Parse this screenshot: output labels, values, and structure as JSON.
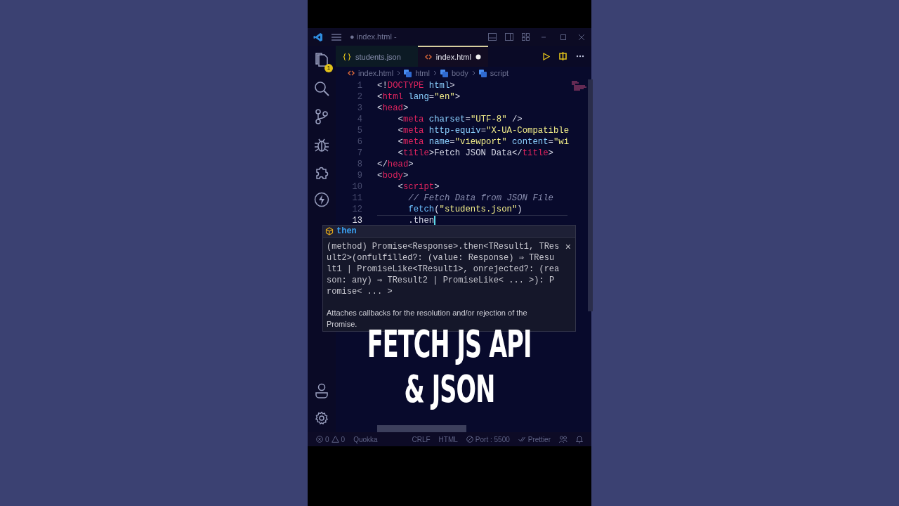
{
  "window": {
    "title": "● index.html -"
  },
  "activity_bar": {
    "explorer_badge": "1"
  },
  "tabs": [
    {
      "label": "students.json",
      "kind": "json",
      "selected": false,
      "modified": false
    },
    {
      "label": "index.html",
      "kind": "html",
      "selected": true,
      "modified": true
    }
  ],
  "breadcrumb": [
    {
      "label": "index.html",
      "kind": "file"
    },
    {
      "label": "html",
      "kind": "element"
    },
    {
      "label": "body",
      "kind": "element"
    },
    {
      "label": "script",
      "kind": "element"
    }
  ],
  "editor": {
    "lines": [
      {
        "number": "1",
        "current": false,
        "tokens": [
          {
            "kind": "punct",
            "text": "<!"
          },
          {
            "kind": "tag",
            "text": "DOCTYPE"
          },
          {
            "kind": "attr",
            "text": " html"
          },
          {
            "kind": "punct",
            "text": ">"
          }
        ]
      },
      {
        "number": "2",
        "current": false,
        "tokens": [
          {
            "kind": "punct",
            "text": "<"
          },
          {
            "kind": "tag",
            "text": "html"
          },
          {
            "kind": "attr",
            "text": " lang"
          },
          {
            "kind": "punct",
            "text": "="
          },
          {
            "kind": "string",
            "text": "\"en\""
          },
          {
            "kind": "punct",
            "text": ">"
          }
        ]
      },
      {
        "number": "3",
        "current": false,
        "tokens": [
          {
            "kind": "punct",
            "text": "<"
          },
          {
            "kind": "tag",
            "text": "head"
          },
          {
            "kind": "punct",
            "text": ">"
          }
        ]
      },
      {
        "number": "4",
        "current": false,
        "tokens": [
          {
            "kind": "punct",
            "text": "    <"
          },
          {
            "kind": "tag",
            "text": "meta"
          },
          {
            "kind": "attr",
            "text": " charset"
          },
          {
            "kind": "punct",
            "text": "="
          },
          {
            "kind": "string",
            "text": "\"UTF-8\""
          },
          {
            "kind": "punct",
            "text": " />"
          }
        ]
      },
      {
        "number": "5",
        "current": false,
        "tokens": [
          {
            "kind": "punct",
            "text": "    <"
          },
          {
            "kind": "tag",
            "text": "meta"
          },
          {
            "kind": "attr",
            "text": " http-equiv"
          },
          {
            "kind": "punct",
            "text": "="
          },
          {
            "kind": "string",
            "text": "\"X-UA-Compatible"
          }
        ]
      },
      {
        "number": "6",
        "current": false,
        "tokens": [
          {
            "kind": "punct",
            "text": "    <"
          },
          {
            "kind": "tag",
            "text": "meta"
          },
          {
            "kind": "attr",
            "text": " name"
          },
          {
            "kind": "punct",
            "text": "="
          },
          {
            "kind": "string",
            "text": "\"viewport\""
          },
          {
            "kind": "attr",
            "text": " content"
          },
          {
            "kind": "punct",
            "text": "="
          },
          {
            "kind": "string",
            "text": "\"wi"
          }
        ]
      },
      {
        "number": "7",
        "current": false,
        "tokens": [
          {
            "kind": "punct",
            "text": "    <"
          },
          {
            "kind": "tag",
            "text": "title"
          },
          {
            "kind": "punct",
            "text": ">Fetch JSON Data</"
          },
          {
            "kind": "tag",
            "text": "title"
          },
          {
            "kind": "punct",
            "text": ">"
          }
        ]
      },
      {
        "number": "8",
        "current": false,
        "tokens": [
          {
            "kind": "punct",
            "text": "</"
          },
          {
            "kind": "tag",
            "text": "head"
          },
          {
            "kind": "punct",
            "text": ">"
          }
        ]
      },
      {
        "number": "9",
        "current": false,
        "tokens": [
          {
            "kind": "punct",
            "text": "<"
          },
          {
            "kind": "tag",
            "text": "body"
          },
          {
            "kind": "punct",
            "text": ">"
          }
        ]
      },
      {
        "number": "10",
        "current": false,
        "tokens": [
          {
            "kind": "punct",
            "text": "    <"
          },
          {
            "kind": "tag",
            "text": "script"
          },
          {
            "kind": "punct",
            "text": ">"
          }
        ]
      },
      {
        "number": "11",
        "current": false,
        "tokens": [
          {
            "kind": "comment",
            "text": "      // Fetch Data from JSON File"
          }
        ]
      },
      {
        "number": "12",
        "current": false,
        "tokens": [
          {
            "kind": "func",
            "text": "      fetch"
          },
          {
            "kind": "punct",
            "text": "("
          },
          {
            "kind": "string",
            "text": "\"students.json\""
          },
          {
            "kind": "punct",
            "text": ")"
          }
        ]
      },
      {
        "number": "13",
        "current": true,
        "tokens": [
          {
            "kind": "punct",
            "text": "      .then"
          }
        ]
      }
    ]
  },
  "hover": {
    "suggestion": "then",
    "signature": "(method) Promise<Response>.then<TResult1, TResult2>(onfulfilled?: (value: Response) ⇒ TResult1 | PromiseLike<TResult1>, onrejected?: (reason: any) ⇒ TResult2 | PromiseLike< ... >): Promise< ... >",
    "close": "×",
    "description": "Attaches callbacks for the resolution and/or rejection of the Promise."
  },
  "caption": [
    "FETCH JS API",
    "& JSON"
  ],
  "status_bar": {
    "errors": "0",
    "warnings": "0",
    "items": [
      {
        "kind": "plain",
        "text": "Quokka"
      },
      {
        "kind": "plain",
        "text": "CRLF"
      },
      {
        "kind": "plain",
        "text": "HTML"
      },
      {
        "kind": "port",
        "text": "Port : 5500"
      },
      {
        "kind": "prettier",
        "text": "Prettier"
      }
    ]
  }
}
